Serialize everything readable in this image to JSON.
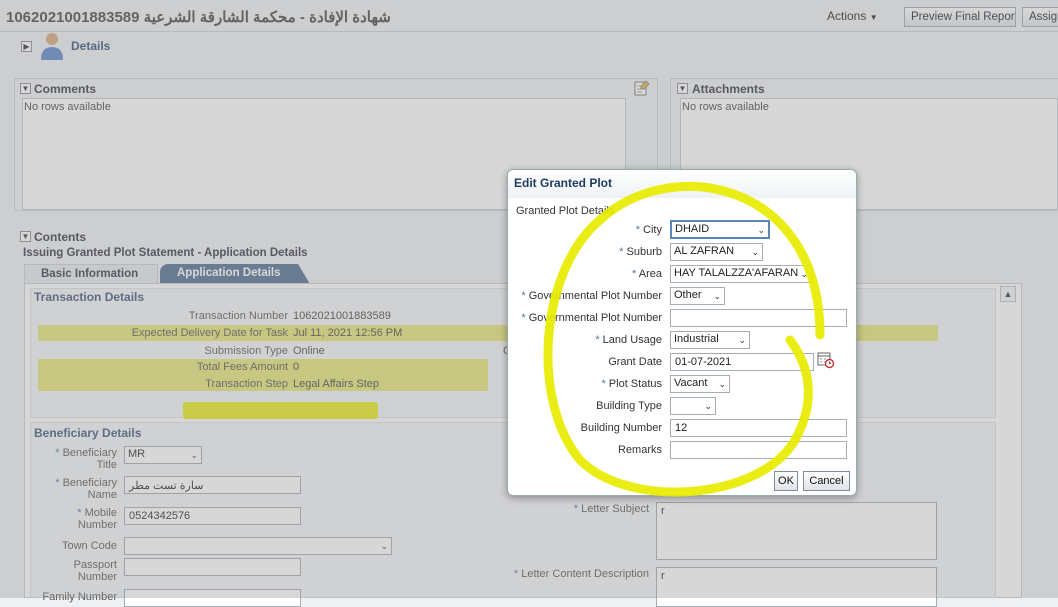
{
  "header": {
    "title": "شهادة الإفادة - محكمة الشارقة الشرعية 1062021001883589",
    "actions_label": "Actions",
    "preview_button": "Preview Final Report",
    "assign_button": "Assign"
  },
  "details": {
    "title": "Details"
  },
  "comments": {
    "title": "Comments",
    "empty": "No rows available"
  },
  "attachments": {
    "title": "Attachments",
    "empty": "No rows available"
  },
  "contents": {
    "title": "Contents",
    "subtitle": "Issuing Granted Plot Statement - Application Details",
    "tabs": [
      {
        "label": "Basic Information"
      },
      {
        "label": "Application Details"
      }
    ]
  },
  "transaction": {
    "title": "Transaction Details",
    "fields": [
      {
        "label": "Transaction Number",
        "value": "1062021001883589"
      },
      {
        "label": "Expected Delivery Date for Task",
        "value": "Jul 11, 2021 12:56 PM"
      },
      {
        "label": "Submission Type",
        "value": "Online"
      },
      {
        "label": "Total Fees Amount",
        "value": "0"
      },
      {
        "label": "Transaction Step",
        "value": "Legal Affairs Step"
      }
    ],
    "stray_char": "O"
  },
  "beneficiary": {
    "title": "Beneficiary Details",
    "title_label": "Beneficiary Title",
    "title_value": "MR",
    "name_label": "Beneficiary Name",
    "name_value": "سارة تست مطر",
    "mobile_label": "Mobile Number",
    "mobile_value": "0524342576",
    "town_label": "Town Code",
    "passport_label": "Passport Number",
    "family_label": "Family Number"
  },
  "letter": {
    "subject_label": "Letter Subject",
    "subject_value": "r",
    "content_label": "Letter Content Description",
    "content_value": "r"
  },
  "dialog": {
    "title": "Edit Granted Plot",
    "section": "Granted Plot Details",
    "fields": [
      {
        "label": "City",
        "value": "DHAID",
        "required": true
      },
      {
        "label": "Suburb",
        "value": "AL ZAFRAN",
        "required": true
      },
      {
        "label": "Area",
        "value": "HAY TALALZZA'AFARAN",
        "required": true
      },
      {
        "label": "Governmental Plot Number",
        "value": "Other",
        "required": true
      },
      {
        "label": "Governmental Plot Number",
        "value": "",
        "required": true
      },
      {
        "label": "Land Usage",
        "value": "Industrial",
        "required": true
      },
      {
        "label": "Grant Date",
        "value": "01-07-2021",
        "required": false
      },
      {
        "label": "Plot Status",
        "value": "Vacant",
        "required": true
      },
      {
        "label": "Building Type",
        "value": "",
        "required": false
      },
      {
        "label": "Building Number",
        "value": "12",
        "required": false
      },
      {
        "label": "Remarks",
        "value": "",
        "required": false
      }
    ],
    "ok_label": "OK",
    "cancel_label": "Cancel"
  },
  "colors": {
    "highlight": "#e6e675",
    "annotation": "#e8ec00",
    "dialog_title": "#1e3c64"
  }
}
